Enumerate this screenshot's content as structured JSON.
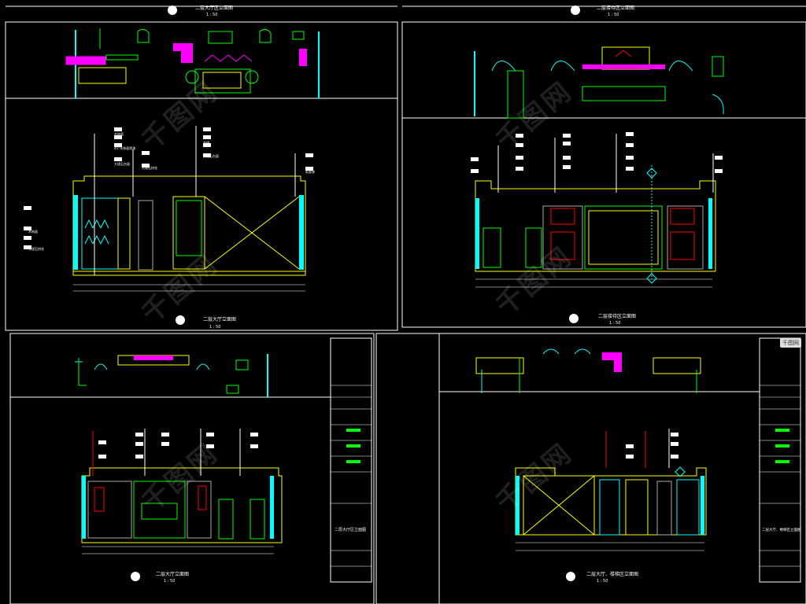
{
  "sheets": [
    {
      "id": "sheet-top-left",
      "title": "二层大厅立面图",
      "scale": "1 : 50",
      "plan_title": "二层大厅区立面图",
      "plan_scale": "1 : 50",
      "mark": "E-04"
    },
    {
      "id": "sheet-top-right",
      "title": "二层接待区立面图",
      "scale": "1 : 50",
      "plan_title": "二层接待区立面图",
      "plan_scale": "1 : 50",
      "mark": "E-11"
    },
    {
      "id": "sheet-bottom-left",
      "title": "二层大厅立面图",
      "scale": "1 : 50",
      "mark": "E-03",
      "titleblock_name": "二层大厅区立面图"
    },
    {
      "id": "sheet-bottom-right",
      "title": "二层大厅、楼梯区立面图",
      "scale": "1 : 50",
      "mark": "E-05",
      "titleblock_name": "二层大厅、楼梯区立面图"
    }
  ],
  "callouts_left": [
    "木饰面",
    "45°木饰面喷漆",
    "大理石台面",
    "木饰面",
    "大理石拼花"
  ],
  "callouts_mid": [
    "灰镜",
    "大理石台面",
    "大理石拼花",
    "石材"
  ],
  "callouts_right": [
    "乳胶漆",
    "大理石拼花"
  ],
  "watermark": "千图网",
  "badge": "千图网",
  "colors": {
    "yellow": "#ffff00",
    "cyan": "#00ffff",
    "magenta": "#ff00ff",
    "green": "#00ff00",
    "red": "#ff0000",
    "white": "#ffffff"
  }
}
